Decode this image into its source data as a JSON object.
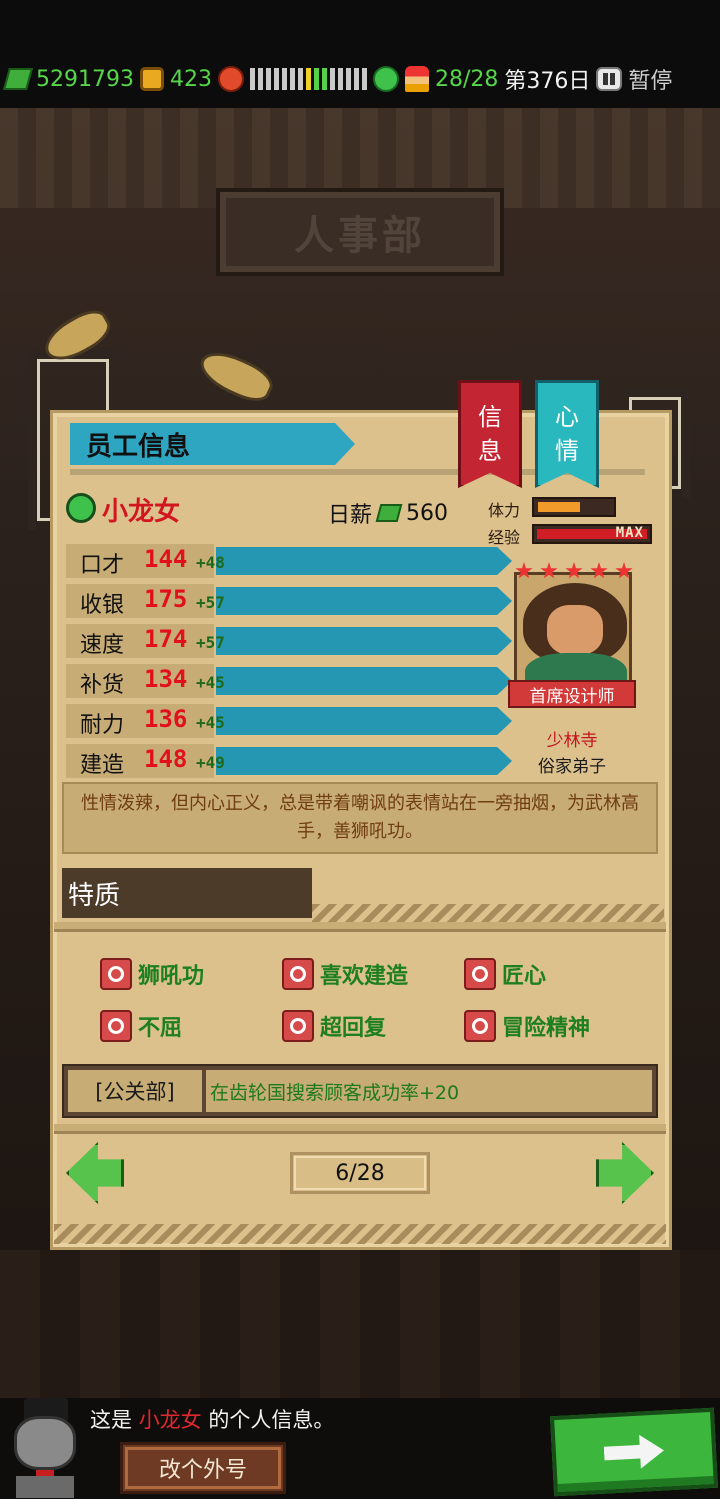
{
  "topbar": {
    "money": "5291793",
    "coins": "423",
    "staff": "28/28",
    "day": "第376日",
    "pause_label": "暂停"
  },
  "mood_segments": [
    "gray",
    "gray",
    "gray",
    "gray",
    "gray",
    "gray",
    "gray",
    "yellow",
    "green",
    "green",
    "gray",
    "gray",
    "gray",
    "gray",
    "gray"
  ],
  "department_sign": "人事部",
  "panel": {
    "title": "员工信息",
    "tabs": {
      "info": [
        "信",
        "息"
      ],
      "mood": [
        "心",
        "情"
      ]
    },
    "employee": {
      "name": "小龙女",
      "salary_label": "日薪",
      "salary_value": "560",
      "stamina_label": "体力",
      "stamina_level": 0.55,
      "exp_label": "经验",
      "exp_max_text": "MAX",
      "title_badge": "首席设计师",
      "sect": "少林寺",
      "rank": "俗家弟子",
      "stars": 5
    },
    "attributes": [
      {
        "name": "口才",
        "value": "144",
        "bonus": "+48"
      },
      {
        "name": "收银",
        "value": "175",
        "bonus": "+57"
      },
      {
        "name": "速度",
        "value": "174",
        "bonus": "+57"
      },
      {
        "name": "补货",
        "value": "134",
        "bonus": "+45"
      },
      {
        "name": "耐力",
        "value": "136",
        "bonus": "+45"
      },
      {
        "name": "建造",
        "value": "148",
        "bonus": "+49"
      }
    ],
    "description": "性情泼辣，但内心正义，总是带着嘲讽的表情站在一旁抽烟，为武林高手，善狮吼功。",
    "traits_heading": "特质",
    "traits": [
      "狮吼功",
      "喜欢建造",
      "匠心",
      "不屈",
      "超回复",
      "冒险精神"
    ],
    "department": {
      "name": "[公关部]",
      "effect": "在齿轮国搜索顾客成功率+20"
    },
    "pager": "6/28"
  },
  "dialog": {
    "prefix": "这是 ",
    "name": "小龙女",
    "suffix": " 的个人信息。",
    "rename_label": "改个外号"
  },
  "colors": {
    "accent_green": "#57d64a",
    "name_red": "#d2151f",
    "bar_blue": "#2597b3",
    "panel_bg": "#dcc18d"
  }
}
